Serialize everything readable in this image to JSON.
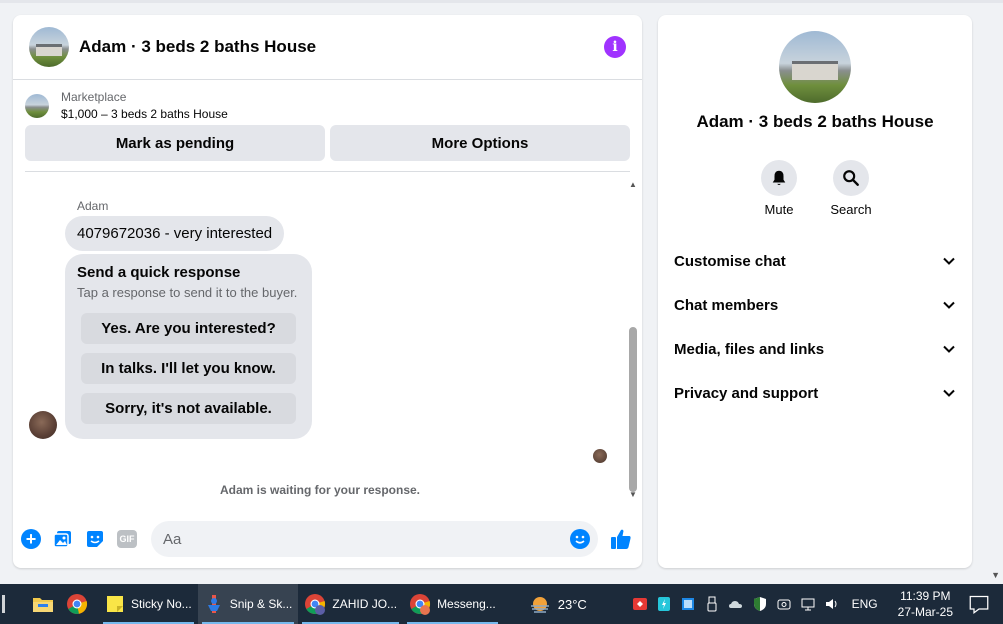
{
  "chat": {
    "title": "Adam · 3 beds 2 baths House",
    "marketplace_label": "Marketplace",
    "listing": "$1,000 – 3 beds 2 baths House",
    "mark_pending_label": "Mark as pending",
    "more_options_label": "More Options",
    "sender": "Adam",
    "message": "4079672036 - very interested",
    "quick_response_title": "Send a quick response",
    "quick_response_sub": "Tap a response to send it to the buyer.",
    "quick_responses": [
      "Yes. Are you interested?",
      "In talks. I'll let you know.",
      "Sorry, it's not available."
    ],
    "waiting_text": "Adam is waiting for your response.",
    "input_placeholder": "Aa"
  },
  "info_panel": {
    "name": "Adam · 3 beds 2 baths House",
    "actions": [
      {
        "label": "Mute",
        "icon": "bell-icon"
      },
      {
        "label": "Search",
        "icon": "search-icon"
      }
    ],
    "sections": [
      "Customise chat",
      "Chat members",
      "Media, files and links",
      "Privacy and support"
    ]
  },
  "taskbar": {
    "apps": [
      {
        "label": "Sticky No...",
        "icon": "sticky-notes-icon"
      },
      {
        "label": "Snip & Sk...",
        "icon": "snip-sketch-icon"
      },
      {
        "label": "ZAHID JO...",
        "icon": "chrome-profile-icon"
      },
      {
        "label": "Messeng...",
        "icon": "chrome-messenger-icon"
      }
    ],
    "temperature": "23°C",
    "language": "ENG",
    "time": "11:39 PM",
    "date": "27-Mar-25"
  },
  "colors": {
    "messenger_blue": "#0084ff",
    "info_purple": "#a033ff",
    "taskbar_bg": "#1c2a3a"
  }
}
